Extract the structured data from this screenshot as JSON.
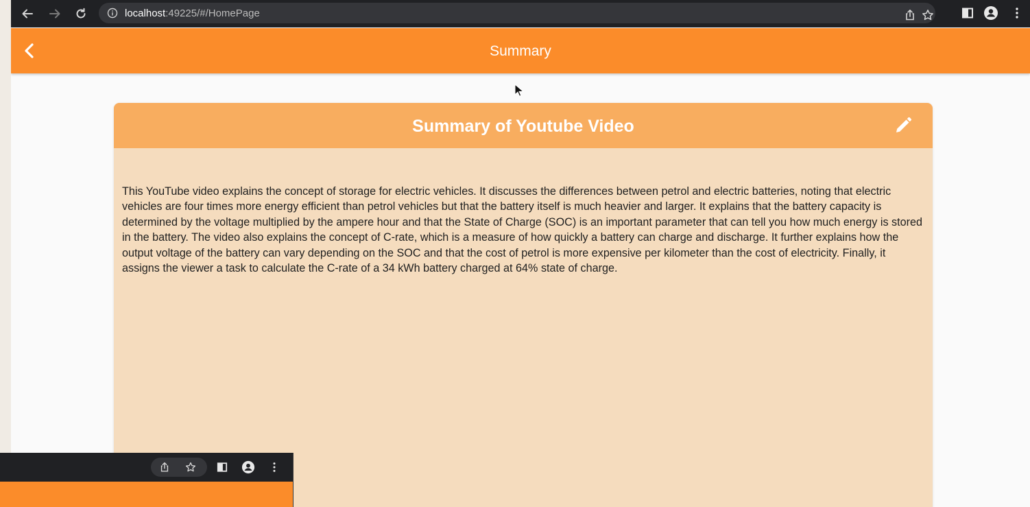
{
  "browser": {
    "url_host": "localhost",
    "url_rest": ":49225/#/HomePage"
  },
  "app_bar": {
    "title": "Summary"
  },
  "card": {
    "title": "Summary of Youtube Video",
    "body": "This YouTube video explains the concept of storage for electric vehicles. It discusses the differences between petrol and electric batteries, noting that electric vehicles are four times more energy efficient than petrol vehicles but that the battery itself is much heavier and larger. It explains that the battery capacity is determined by the voltage multiplied by the ampere hour and that the State of Charge (SOC) is an important parameter that can tell you how much energy is stored in the battery. The video also explains the concept of C-rate, which is a measure of how quickly a battery can charge and discharge. It further explains how the output voltage of the battery can vary depending on the SOC and that the cost of petrol is more expensive per kilometer than the cost of electricity. Finally, it assigns the viewer a task to calculate the C-rate of a 34 kWh battery charged at 64% state of charge."
  },
  "colors": {
    "app_bar": "#fb8c2a",
    "card_header": "#f8ad5f",
    "card_body": "#f5dcbe",
    "chrome": "#202124"
  },
  "icons": {
    "back": "back-arrow-icon",
    "forward": "forward-arrow-icon",
    "reload": "reload-icon",
    "site_info": "info-icon",
    "share": "share-icon",
    "bookmark": "star-icon",
    "side_panel": "side-panel-icon",
    "profile": "profile-icon",
    "menu": "kebab-menu-icon",
    "app_back": "chevron-left-icon",
    "edit": "pencil-icon"
  }
}
